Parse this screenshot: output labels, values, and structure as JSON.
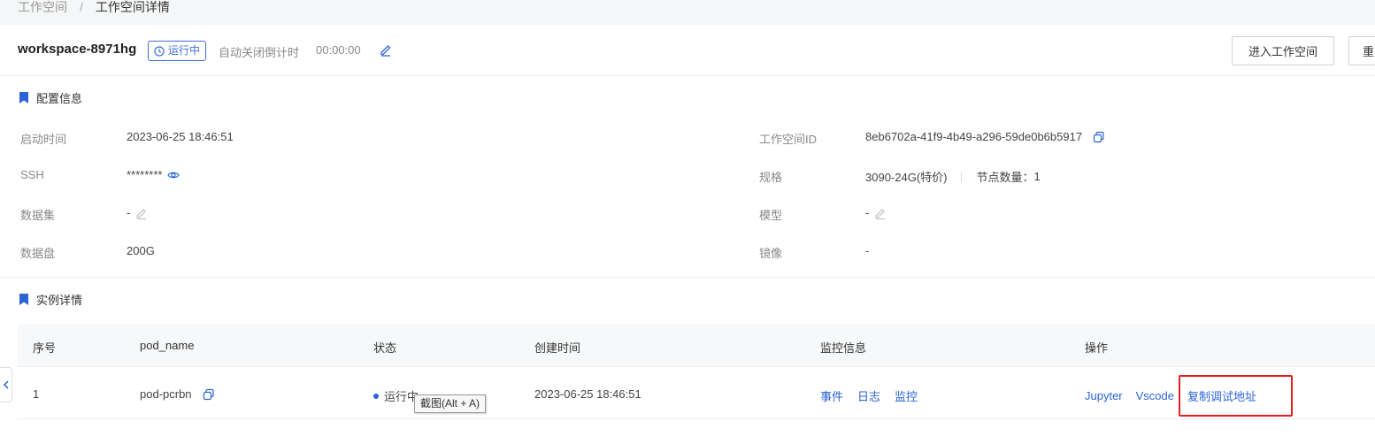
{
  "breadcrumb": {
    "root": "工作空间",
    "separator": "/",
    "current": "工作空间详情"
  },
  "header": {
    "workspace_name": "workspace-8971hg",
    "status": "运行中",
    "countdown_label": "自动关闭倒计时",
    "countdown_value": "00:00:00",
    "enter_button": "进入工作空间",
    "restart_button": "重"
  },
  "config": {
    "title": "配置信息",
    "start_time_label": "启动时间",
    "start_time_value": "2023-06-25 18:46:51",
    "ssh_label": "SSH",
    "ssh_value": "********",
    "dataset_label": "数据集",
    "dataset_value": "-",
    "datadisk_label": "数据盘",
    "datadisk_value": "200G",
    "workspace_id_label": "工作空间ID",
    "workspace_id_value": "8eb6702a-41f9-4b49-a296-59de0b6b5917",
    "spec_label": "规格",
    "spec_value": "3090-24G(特价)",
    "node_count_label": "节点数量：",
    "node_count_value": "1",
    "model_label": "模型",
    "model_value": "-",
    "image_label": "镜像",
    "image_value": "-"
  },
  "instance": {
    "title": "实例详情",
    "columns": [
      "序号",
      "pod_name",
      "状态",
      "创建时间",
      "监控信息",
      "操作"
    ],
    "row": {
      "index": "1",
      "pod_name": "pod-pcrbn",
      "status": "运行中",
      "created": "2023-06-25 18:46:51",
      "monitor_links": [
        "事件",
        "日志",
        "监控"
      ],
      "actions": [
        "Jupyter",
        "Vscode",
        "复制调试地址"
      ]
    }
  },
  "tooltip": "截图(Alt + A)",
  "colors": {
    "accent": "#2b63d9",
    "highlight": "#e02020"
  }
}
